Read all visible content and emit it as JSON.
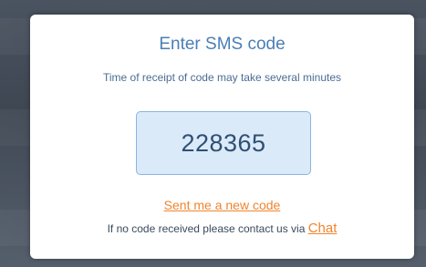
{
  "dialog": {
    "title": "Enter SMS code",
    "subtitle": "Time of receipt of code may take several minutes",
    "code_value": "228365",
    "resend_link": "Sent me a new code",
    "contact_text": "If no code received please contact us via",
    "chat_link": "Chat"
  },
  "colors": {
    "accent": "#f0842c",
    "title": "#4a7fb5",
    "code_box_bg": "#dbeaf9"
  }
}
